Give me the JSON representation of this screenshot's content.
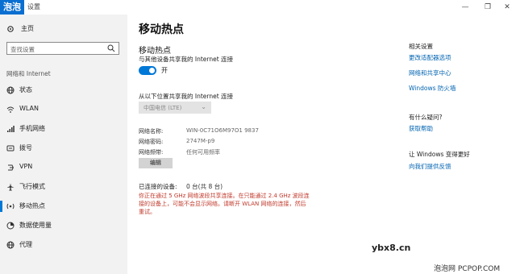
{
  "titlebar": {
    "watermark": "泡泡",
    "title": "设置",
    "min_symbol": "—",
    "max_symbol": "❐",
    "close_symbol": "✕"
  },
  "sidebar": {
    "home": "主页",
    "search_placeholder": "查找设置",
    "section": "网络和 Internet",
    "items": [
      {
        "label": "状态",
        "icon": "globe-icon"
      },
      {
        "label": "WLAN",
        "icon": "wifi-icon"
      },
      {
        "label": "手机网络",
        "icon": "signal-icon"
      },
      {
        "label": "拨号",
        "icon": "dialup-icon"
      },
      {
        "label": "VPN",
        "icon": "vpn-icon"
      },
      {
        "label": "飞行模式",
        "icon": "airplane-icon"
      },
      {
        "label": "移动热点",
        "icon": "hotspot-icon"
      },
      {
        "label": "数据使用量",
        "icon": "data-usage-icon"
      },
      {
        "label": "代理",
        "icon": "globe-icon"
      }
    ],
    "active_index": 6
  },
  "main": {
    "title": "移动热点",
    "section_title": "移动热点",
    "share_desc": "与其他设备共享我的 Internet 连接",
    "toggle_label": "开",
    "toggle_on": true,
    "share_from_label": "从以下位置共享我的 Internet 连接",
    "dropdown_value": "中国电信 (LTE)",
    "network_name_label": "网络名称:",
    "network_name": "WIN-0C71O6M97O1 9837",
    "password_label": "网络密码:",
    "password": "2747M-p9",
    "band_label": "网络频带:",
    "band": "任何可用频率",
    "edit_button": "编辑",
    "connected_label": "已连接的设备:",
    "connected_value": "0 台(共 8 台)",
    "warning_line1": "你正在通过 5 GHz 网络波段共享连接。在只能通过 2.4 GHz 波段连",
    "warning_line2": "接的设备上，可能不会显示网络。请断开 WLAN 网络的连接，然后",
    "warning_line3": "重试。"
  },
  "right": {
    "related_heading": "相关设置",
    "link1": "更改适配器选项",
    "link2": "网络和共享中心",
    "link3": "Windows 防火墙",
    "question_heading": "有什么疑问?",
    "help_link": "获取帮助",
    "improve_heading": "让 Windows 变得更好",
    "feedback_link": "向我们提供反馈"
  },
  "watermarks": {
    "site1": "ybx8.cn",
    "site2": "泡泡网 PCPOP.COM"
  },
  "colors": {
    "accent": "#0078d7",
    "link": "#0063b1",
    "warning": "#c0392b",
    "sidebar_bg": "#f2f2f2"
  }
}
